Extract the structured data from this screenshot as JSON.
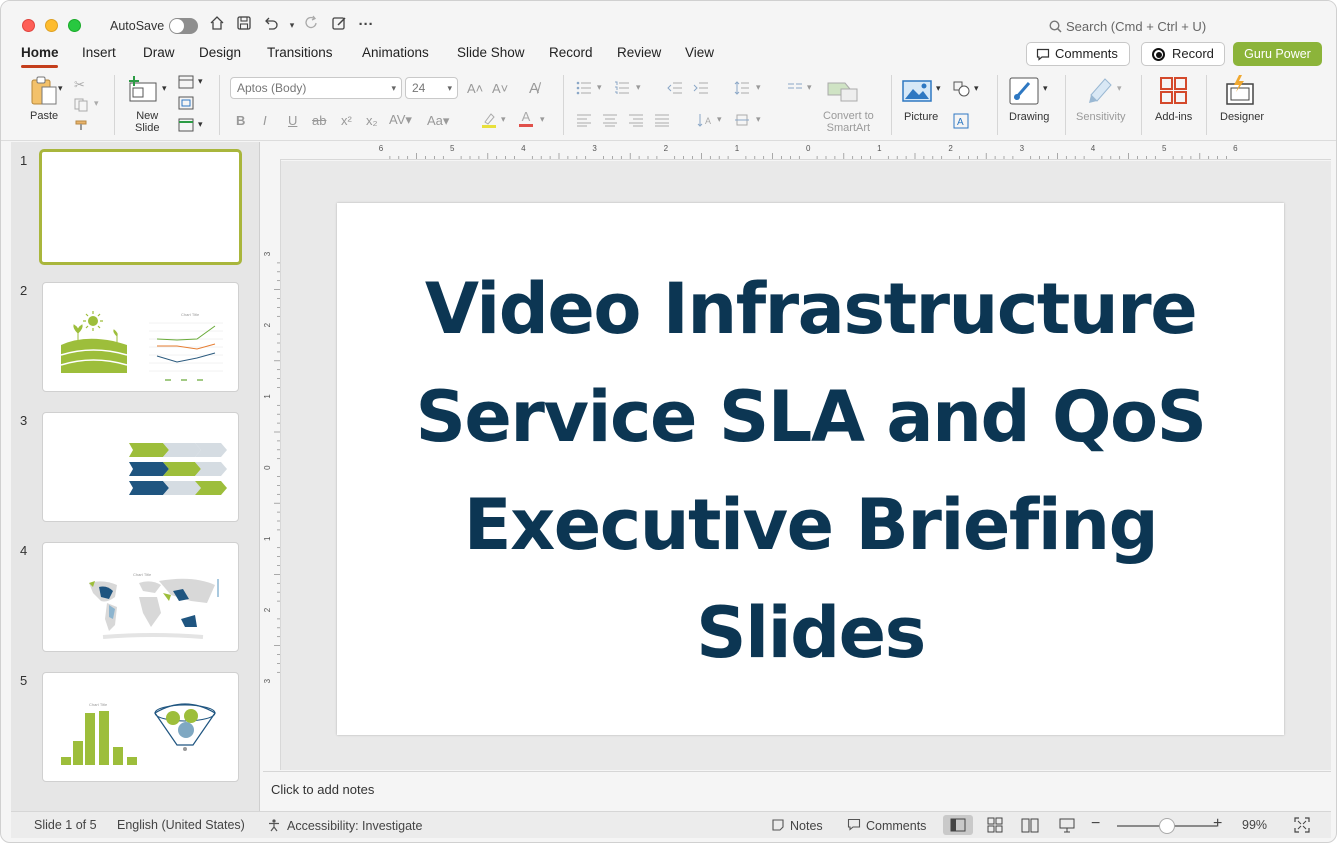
{
  "titlebar": {
    "autosave_label": "AutoSave",
    "search_placeholder": "Search (Cmd + Ctrl + U)"
  },
  "tabs": [
    {
      "label": "Home"
    },
    {
      "label": "Insert"
    },
    {
      "label": "Draw"
    },
    {
      "label": "Design"
    },
    {
      "label": "Transitions"
    },
    {
      "label": "Animations"
    },
    {
      "label": "Slide Show"
    },
    {
      "label": "Record"
    },
    {
      "label": "Review"
    },
    {
      "label": "View"
    }
  ],
  "header_buttons": {
    "comments": "Comments",
    "record": "Record",
    "guru": "Guru Power"
  },
  "ribbon": {
    "paste": "Paste",
    "new_slide_line1": "New",
    "new_slide_line2": "Slide",
    "font_name": "Aptos (Body)",
    "font_size": "24",
    "convert_line1": "Convert to",
    "convert_line2": "SmartArt",
    "picture": "Picture",
    "drawing": "Drawing",
    "sensitivity": "Sensitivity",
    "addins": "Add-ins",
    "designer": "Designer"
  },
  "slides": [
    {
      "number": "1"
    },
    {
      "number": "2"
    },
    {
      "number": "3"
    },
    {
      "number": "4"
    },
    {
      "number": "5"
    }
  ],
  "ruler": {
    "h_ticks": [
      "6",
      "5",
      "4",
      "3",
      "2",
      "1",
      "0",
      "1",
      "2",
      "3",
      "4",
      "5",
      "6"
    ],
    "v_ticks": [
      "3",
      "2",
      "1",
      "0",
      "1",
      "2",
      "3"
    ]
  },
  "slide": {
    "title_line1": "Video Infrastructure",
    "title_line2": "Service SLA and QoS",
    "title_line3": "Executive Briefing",
    "title_line4": "Slides"
  },
  "notes_placeholder": "Click to add notes",
  "status": {
    "slide_position": "Slide 1 of 5",
    "language": "English (United States)",
    "accessibility": "Accessibility: Investigate",
    "notes": "Notes",
    "comments": "Comments",
    "zoom": "99%"
  },
  "colors": {
    "accent_tab": "#c43e1c",
    "title_color": "#0c3653",
    "guru_button": "#8cb43a",
    "selected_thumb_border": "#a9b63c"
  }
}
